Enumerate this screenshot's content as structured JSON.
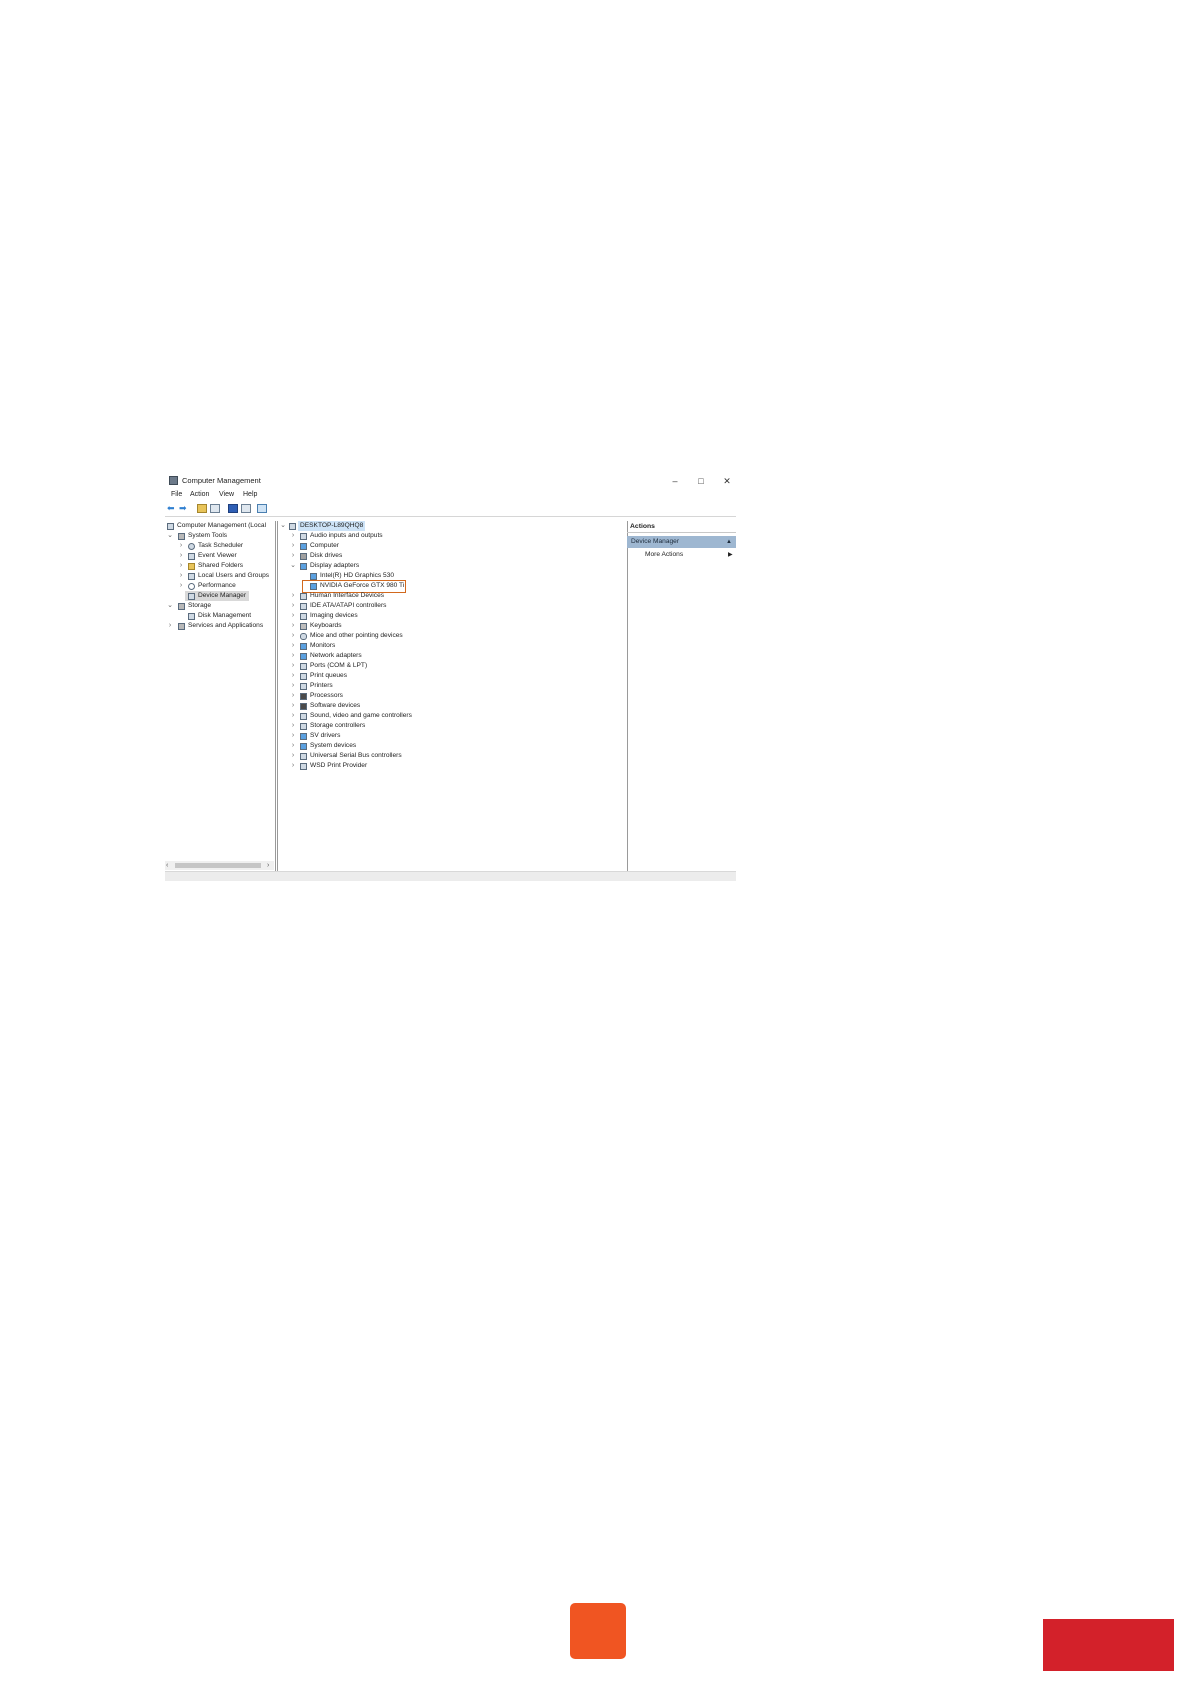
{
  "window": {
    "title": "Computer Management",
    "controls": {
      "minimize": "–",
      "maximize": "□",
      "close": "✕"
    }
  },
  "menu": [
    "File",
    "Action",
    "View",
    "Help"
  ],
  "left_tree": [
    {
      "label": "Computer Management (Local",
      "icon": "computer-management-icon"
    },
    {
      "label": "System Tools",
      "icon": "system-tools-icon"
    },
    {
      "label": "Task Scheduler",
      "icon": "task-scheduler-icon"
    },
    {
      "label": "Event Viewer",
      "icon": "event-viewer-icon"
    },
    {
      "label": "Shared Folders",
      "icon": "shared-folders-icon"
    },
    {
      "label": "Local Users and Groups",
      "icon": "users-icon"
    },
    {
      "label": "Performance",
      "icon": "performance-icon"
    },
    {
      "label": "Device Manager",
      "icon": "device-manager-icon",
      "selected": true
    },
    {
      "label": "Storage",
      "icon": "storage-icon"
    },
    {
      "label": "Disk Management",
      "icon": "disk-management-icon"
    },
    {
      "label": "Services and Applications",
      "icon": "services-icon"
    }
  ],
  "device_tree": {
    "root": "DESKTOP-L89QHQ8",
    "items": [
      "Audio inputs and outputs",
      "Computer",
      "Disk drives",
      "Display adapters",
      "Intel(R) HD Graphics 530",
      "NVIDIA GeForce GTX 980 Ti",
      "Human Interface Devices",
      "IDE ATA/ATAPI controllers",
      "Imaging devices",
      "Keyboards",
      "Mice and other pointing devices",
      "Monitors",
      "Network adapters",
      "Ports (COM & LPT)",
      "Print queues",
      "Printers",
      "Processors",
      "Software devices",
      "Sound, video and game controllers",
      "Storage controllers",
      "SV drivers",
      "System devices",
      "Universal Serial Bus controllers",
      "WSD Print Provider"
    ],
    "highlighted": "NVIDIA GeForce GTX 980 Ti"
  },
  "actions": {
    "header": "Actions",
    "selected": "Device Manager",
    "more": "More Actions",
    "collapse_icon": "▲",
    "more_arrow": "▶"
  },
  "colors": {
    "highlight_border": "#d2691e",
    "orange_button": "#f05522",
    "red_bar": "#d3212a"
  }
}
